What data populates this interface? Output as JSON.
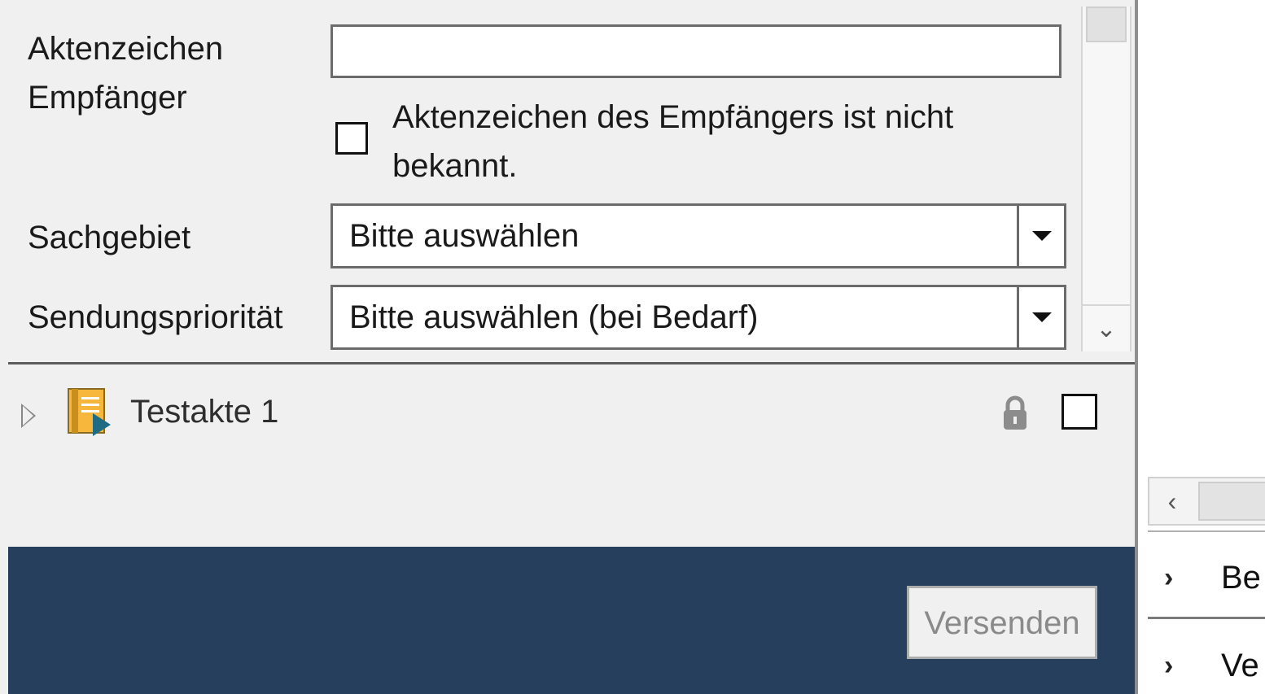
{
  "form": {
    "aktenzeichen_label": "Aktenzeichen\nEmpfänger",
    "aktenzeichen_value": "",
    "unknown_checkbox_label": "Aktenzeichen des Empfängers ist nicht bekannt.",
    "unknown_checkbox_checked": false,
    "sachgebiet_label": "Sachgebiet",
    "sachgebiet_value": "Bitte auswählen",
    "prioritaet_label": "Sendungspriorität",
    "prioritaet_value": "Bitte auswählen (bei Bedarf)"
  },
  "tree": {
    "item_label": "Testakte 1",
    "item_checked": false,
    "item_icon": "file-folder-icon",
    "lock_icon": "lock-icon"
  },
  "footer": {
    "send_label": "Versenden",
    "send_enabled": false,
    "background": "#263f5d"
  },
  "right_panel": {
    "rows": [
      {
        "label": "Be"
      },
      {
        "label": "Ve"
      }
    ]
  }
}
